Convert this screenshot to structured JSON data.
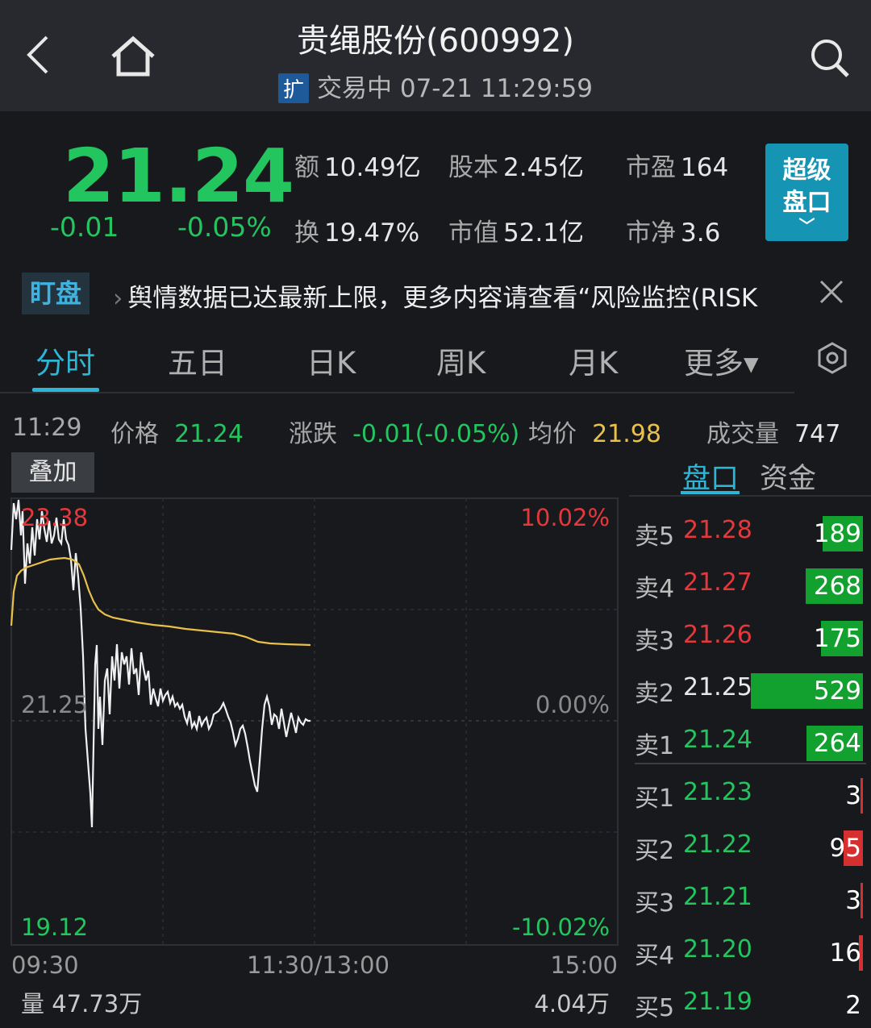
{
  "header": {
    "title": "贵绳股份(600992)",
    "badge": "扩",
    "status": "交易中 07-21 11:29:59"
  },
  "quote": {
    "price": "21.24",
    "change": "-0.01",
    "change_pct": "-0.05%",
    "stats": [
      {
        "key": "额",
        "value": "10.49亿"
      },
      {
        "key": "股本",
        "value": "2.45亿"
      },
      {
        "key": "市盈",
        "value": "164"
      },
      {
        "key": "换",
        "value": "19.47%"
      },
      {
        "key": "市值",
        "value": "52.1亿"
      },
      {
        "key": "市净",
        "value": "3.6"
      }
    ],
    "super_button": {
      "line1": "超级",
      "line2": "盘口",
      "arrow": "﹀"
    }
  },
  "ticker": {
    "tag": "盯盘",
    "message": "舆情数据已达最新上限，更多内容请查看“风险监控(RISK"
  },
  "tabs": [
    {
      "label": "分时"
    },
    {
      "label": "五日"
    },
    {
      "label": "日K"
    },
    {
      "label": "周K"
    },
    {
      "label": "月K"
    },
    {
      "label": "更多▾"
    }
  ],
  "infobar": {
    "time": "11:29",
    "price_label": "价格",
    "price": "21.24",
    "chg_label": "涨跌",
    "chg": "-0.01(-0.05%)",
    "avg_label": "均价",
    "avg": "21.98",
    "vol_label": "成交量",
    "vol": "747"
  },
  "overlay_button": "叠加",
  "panel_tabs": [
    {
      "label": "盘口"
    },
    {
      "label": "资金"
    }
  ],
  "chart_axes": {
    "top_price": "23.38",
    "mid_price": "21.25",
    "bottom_price": "19.12",
    "top_pct": "10.02%",
    "mid_pct": "0.00%",
    "bottom_pct": "-10.02%",
    "time_start": "09:30",
    "time_mid": "11:30/13:00",
    "time_end": "15:00",
    "vol_left": "量 47.73万",
    "vol_right": "4.04万"
  },
  "orderbook": {
    "asks": [
      {
        "label": "卖5",
        "price": "21.28",
        "volume": "189"
      },
      {
        "label": "卖4",
        "price": "21.27",
        "volume": "268"
      },
      {
        "label": "卖3",
        "price": "21.26",
        "volume": "175"
      },
      {
        "label": "卖2",
        "price": "21.25",
        "volume": "529"
      },
      {
        "label": "卖1",
        "price": "21.24",
        "volume": "264"
      }
    ],
    "bids": [
      {
        "label": "买1",
        "price": "21.23",
        "volume": "3"
      },
      {
        "label": "买2",
        "price": "21.22",
        "volume": "95"
      },
      {
        "label": "买3",
        "price": "21.21",
        "volume": "3"
      },
      {
        "label": "买4",
        "price": "21.20",
        "volume": "16"
      },
      {
        "label": "买5",
        "price": "21.19",
        "volume": "2"
      }
    ]
  },
  "colors": {
    "up": "#e5383b",
    "down": "#22c55e",
    "accent": "#2db5d6",
    "avg_line": "#e8c04a"
  }
}
